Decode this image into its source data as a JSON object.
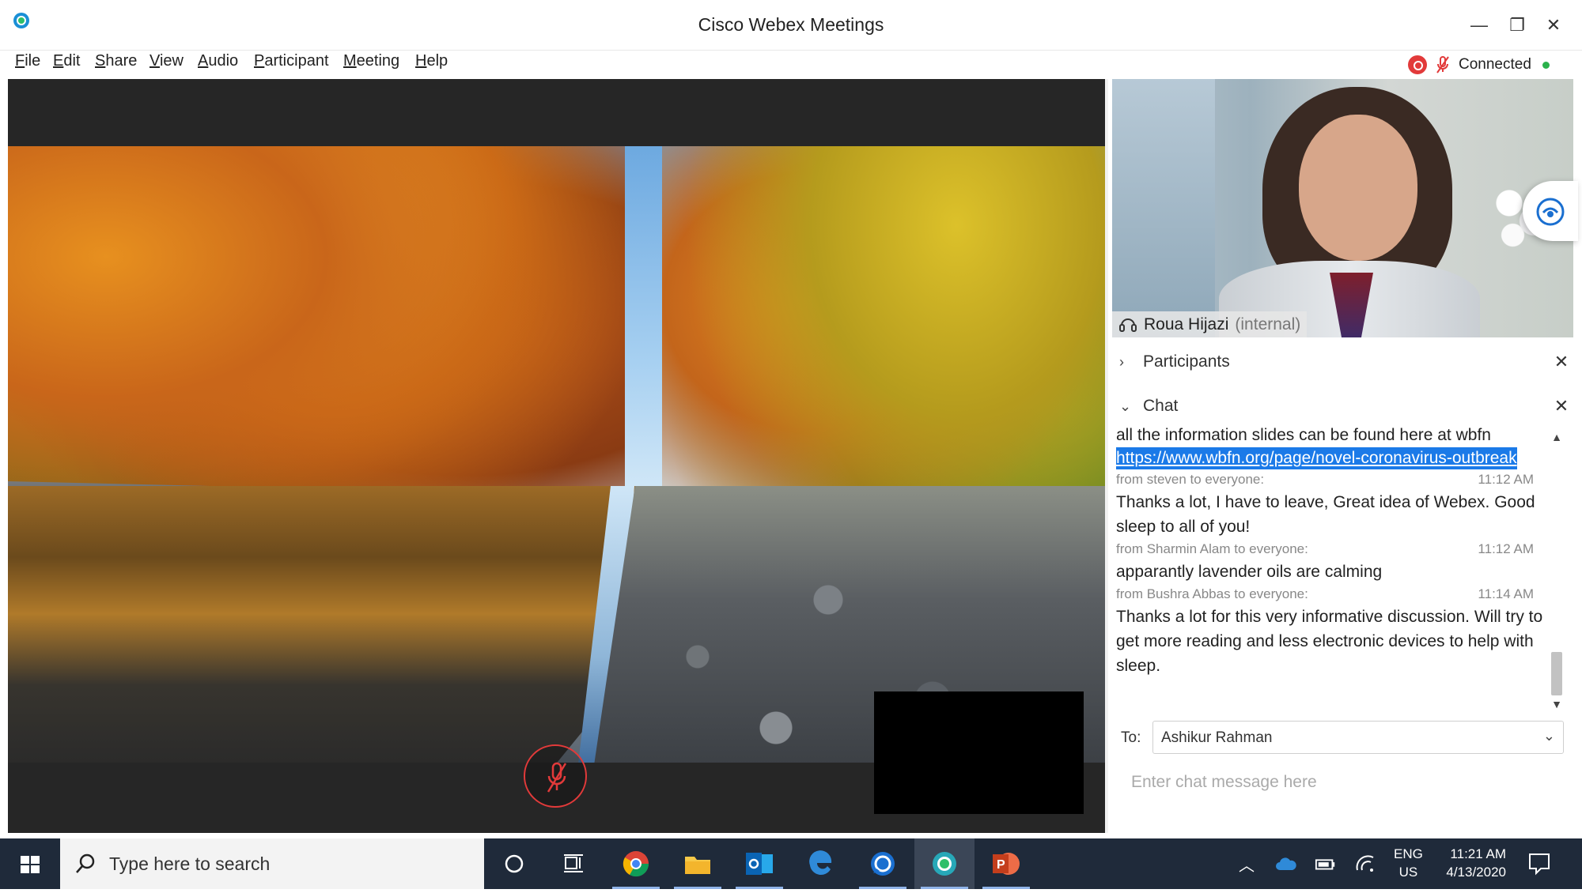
{
  "window": {
    "title": "Cisco Webex Meetings",
    "controls": {
      "minimize": "—",
      "maximize": "❐",
      "close": "✕"
    }
  },
  "menu": [
    "File",
    "Edit",
    "Share",
    "View",
    "Audio",
    "Participant",
    "Meeting",
    "Help"
  ],
  "status": {
    "connection": "Connected",
    "recording_color": "#e23a3a",
    "connected_color": "#2bb24c"
  },
  "video": {
    "participant_name": "Roua Hijazi",
    "participant_tag": "(internal)"
  },
  "panels": {
    "participants_title": "Participants",
    "chat_title": "Chat"
  },
  "chat": {
    "messages": [
      {
        "text": "all the information slides can be found here at wbfn",
        "link": "https://www.wbfn.org/page/novel-coronavirus-outbreak"
      },
      {
        "from": "from steven to everyone:",
        "time": "11:12 AM",
        "text": "Thanks a lot, I have to leave, Great idea of Webex. Good sleep to all of you!"
      },
      {
        "from": "from Sharmin Alam to everyone:",
        "time": "11:12 AM",
        "text": "apparantly lavender oils are calming"
      },
      {
        "from": "from Bushra Abbas to everyone:",
        "time": "11:14 AM",
        "text": "Thanks a lot for this very informative discussion. Will try to get more reading and less electronic devices to help with sleep."
      }
    ],
    "to_label": "To:",
    "to_value": "Ashikur Rahman",
    "input_placeholder": "Enter chat message here"
  },
  "taskbar": {
    "search_placeholder": "Type here to search",
    "apps": [
      "cortana",
      "task-view",
      "chrome",
      "file-explorer",
      "outlook",
      "edge",
      "webex-teams",
      "webex-meetings",
      "powerpoint"
    ],
    "language_line1": "ENG",
    "language_line2": "US",
    "time": "11:21 AM",
    "date": "4/13/2020"
  }
}
